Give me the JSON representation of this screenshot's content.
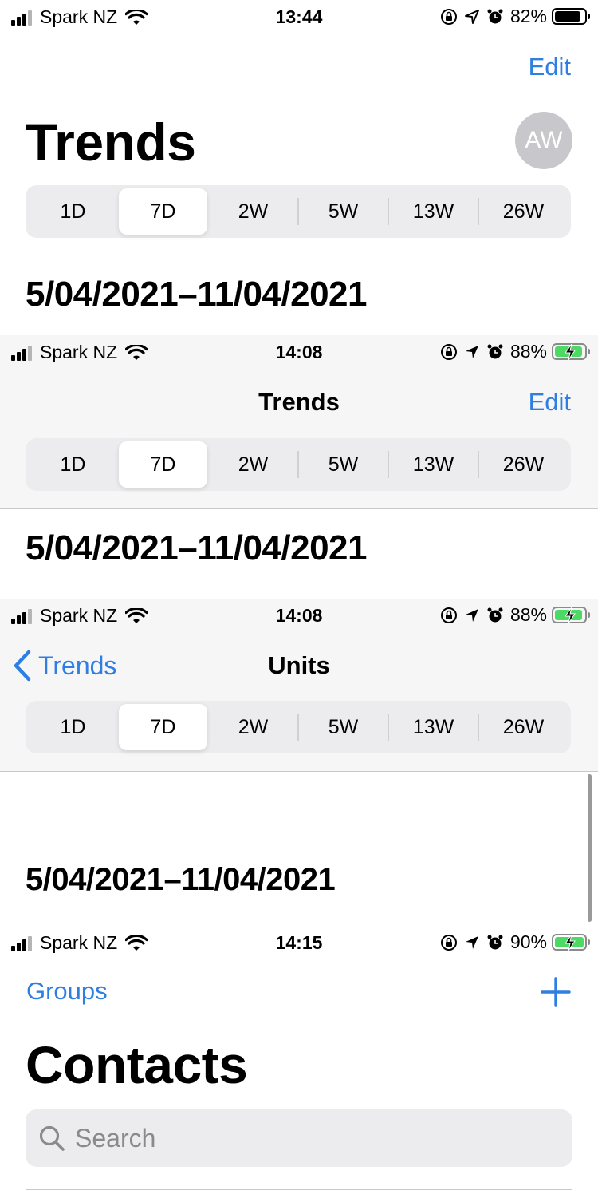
{
  "screens": [
    {
      "status": {
        "carrier": "Spark NZ",
        "time": "13:44",
        "battery": "82%"
      },
      "nav": {
        "edit": "Edit",
        "title": "Trends",
        "avatar": "AW"
      },
      "segments": [
        "1D",
        "7D",
        "2W",
        "5W",
        "13W",
        "26W"
      ],
      "selected_segment": "7D",
      "date_range": "5/04/2021–11/04/2021"
    },
    {
      "status": {
        "carrier": "Spark NZ",
        "time": "14:08",
        "battery": "88%"
      },
      "nav": {
        "title": "Trends",
        "edit": "Edit"
      },
      "segments": [
        "1D",
        "7D",
        "2W",
        "5W",
        "13W",
        "26W"
      ],
      "selected_segment": "7D",
      "date_range": "5/04/2021–11/04/2021"
    },
    {
      "status": {
        "carrier": "Spark NZ",
        "time": "14:08",
        "battery": "88%"
      },
      "nav": {
        "back": "Trends",
        "title": "Units"
      },
      "segments": [
        "1D",
        "7D",
        "2W",
        "5W",
        "13W",
        "26W"
      ],
      "selected_segment": "7D",
      "date_range": "5/04/2021–11/04/2021"
    },
    {
      "status": {
        "carrier": "Spark NZ",
        "time": "14:15",
        "battery": "90%"
      },
      "nav": {
        "groups": "Groups",
        "title": "Contacts"
      },
      "search": {
        "placeholder": "Search"
      }
    }
  ],
  "colors": {
    "accent": "#2f7ee2",
    "charging": "#4cd964"
  },
  "icons": [
    "signal-icon",
    "wifi-icon",
    "orientation-lock-icon",
    "location-icon",
    "alarm-icon",
    "battery-icon",
    "charging-bolt-icon",
    "chevron-left-icon",
    "plus-icon",
    "search-icon"
  ]
}
